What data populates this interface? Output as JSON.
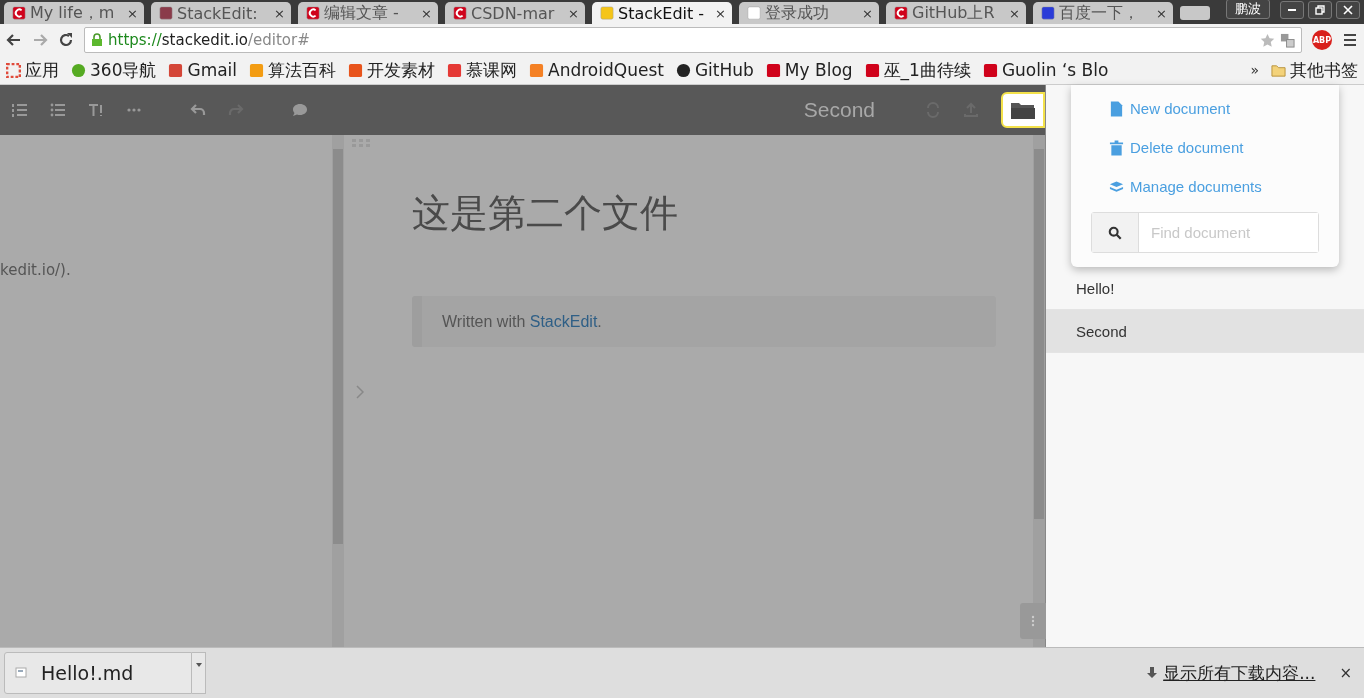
{
  "browser": {
    "tabs": [
      {
        "title": "My life，m",
        "kind": "csdn",
        "selected": false
      },
      {
        "title": "StackEdit:",
        "kind": "bat",
        "selected": false
      },
      {
        "title": "编辑文章 -",
        "kind": "csdn",
        "selected": false
      },
      {
        "title": "CSDN-mar",
        "kind": "csdn",
        "selected": false
      },
      {
        "title": "StackEdit -",
        "kind": "stackedit",
        "selected": true
      },
      {
        "title": "登录成功",
        "kind": "doc",
        "selected": false
      },
      {
        "title": "GitHub上R",
        "kind": "csdn",
        "selected": false
      },
      {
        "title": "百度一下，",
        "kind": "baidu",
        "selected": false
      }
    ],
    "close_glyph": "×",
    "user": "鹏波",
    "url": {
      "scheme": "https://",
      "host": "stackedit.io",
      "path": "/editor#"
    },
    "adblock": "ABP",
    "bookmarks": [
      {
        "label": "应用",
        "kind": "apps"
      },
      {
        "label": "360导航",
        "kind": "ring"
      },
      {
        "label": "Gmail",
        "kind": "gmail"
      },
      {
        "label": "算法百科",
        "kind": "beta"
      },
      {
        "label": "开发素材",
        "kind": "tea"
      },
      {
        "label": "慕课网",
        "kind": "flame"
      },
      {
        "label": "AndroidQuest",
        "kind": "so"
      },
      {
        "label": "GitHub",
        "kind": "github"
      },
      {
        "label": "My Blog",
        "kind": "csdn"
      },
      {
        "label": "巫_1曲待续",
        "kind": "csdn"
      },
      {
        "label": "Guolin ‘s Blo",
        "kind": "csdn"
      }
    ],
    "more": "»",
    "other_bookmarks": "其他书签"
  },
  "editor": {
    "title": "Second",
    "left_text": "kedit.io/).",
    "heading": "这是第二个文件",
    "quote": {
      "prefix": "Written with ",
      "link": "StackEdit",
      "suffix": "."
    }
  },
  "menu": {
    "items": [
      {
        "label": "New document",
        "kind": "file"
      },
      {
        "label": "Delete document",
        "kind": "trash"
      },
      {
        "label": "Manage documents",
        "kind": "layers"
      }
    ],
    "search": {
      "placeholder": "Find document"
    }
  },
  "documents": [
    {
      "name": "Hello!",
      "selected": false
    },
    {
      "name": "Second",
      "selected": true
    }
  ],
  "downloads": {
    "file": "Hello!.md",
    "show_all": "显示所有下载内容...",
    "close": "×"
  }
}
